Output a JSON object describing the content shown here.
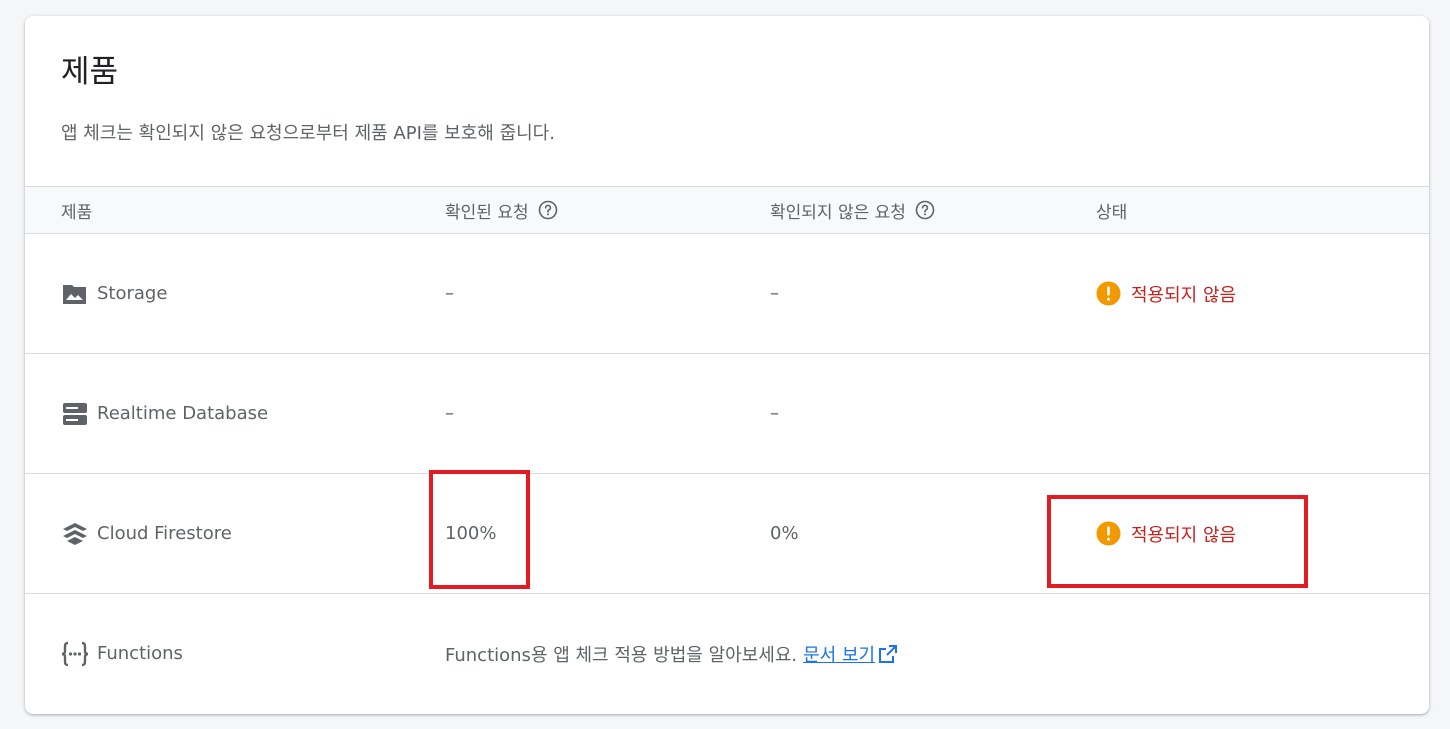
{
  "card": {
    "title": "제품",
    "description": "앱 체크는 확인되지 않은 요청으로부터 제품 API를 보호해 줍니다."
  },
  "table": {
    "headers": {
      "product": "제품",
      "verified": "확인된 요청",
      "unverified": "확인되지 않은 요청",
      "status": "상태"
    },
    "rows": [
      {
        "name": "Storage",
        "icon": "image-folder-icon",
        "verified": "–",
        "unverified": "–",
        "status": "적용되지 않음"
      },
      {
        "name": "Realtime Database",
        "icon": "database-icon",
        "verified": "–",
        "unverified": "–",
        "status": ""
      },
      {
        "name": "Cloud Firestore",
        "icon": "firestore-icon",
        "verified": "100%",
        "unverified": "0%",
        "status": "적용되지 않음"
      },
      {
        "name": "Functions",
        "icon": "functions-icon",
        "note": "Functions용 앱 체크 적용 방법을 알아보세요.",
        "link": "문서 보기"
      }
    ]
  },
  "colors": {
    "warning": "#f29900",
    "status_text": "#c5221f",
    "link": "#1a73e8",
    "highlight": "#e31b23"
  }
}
